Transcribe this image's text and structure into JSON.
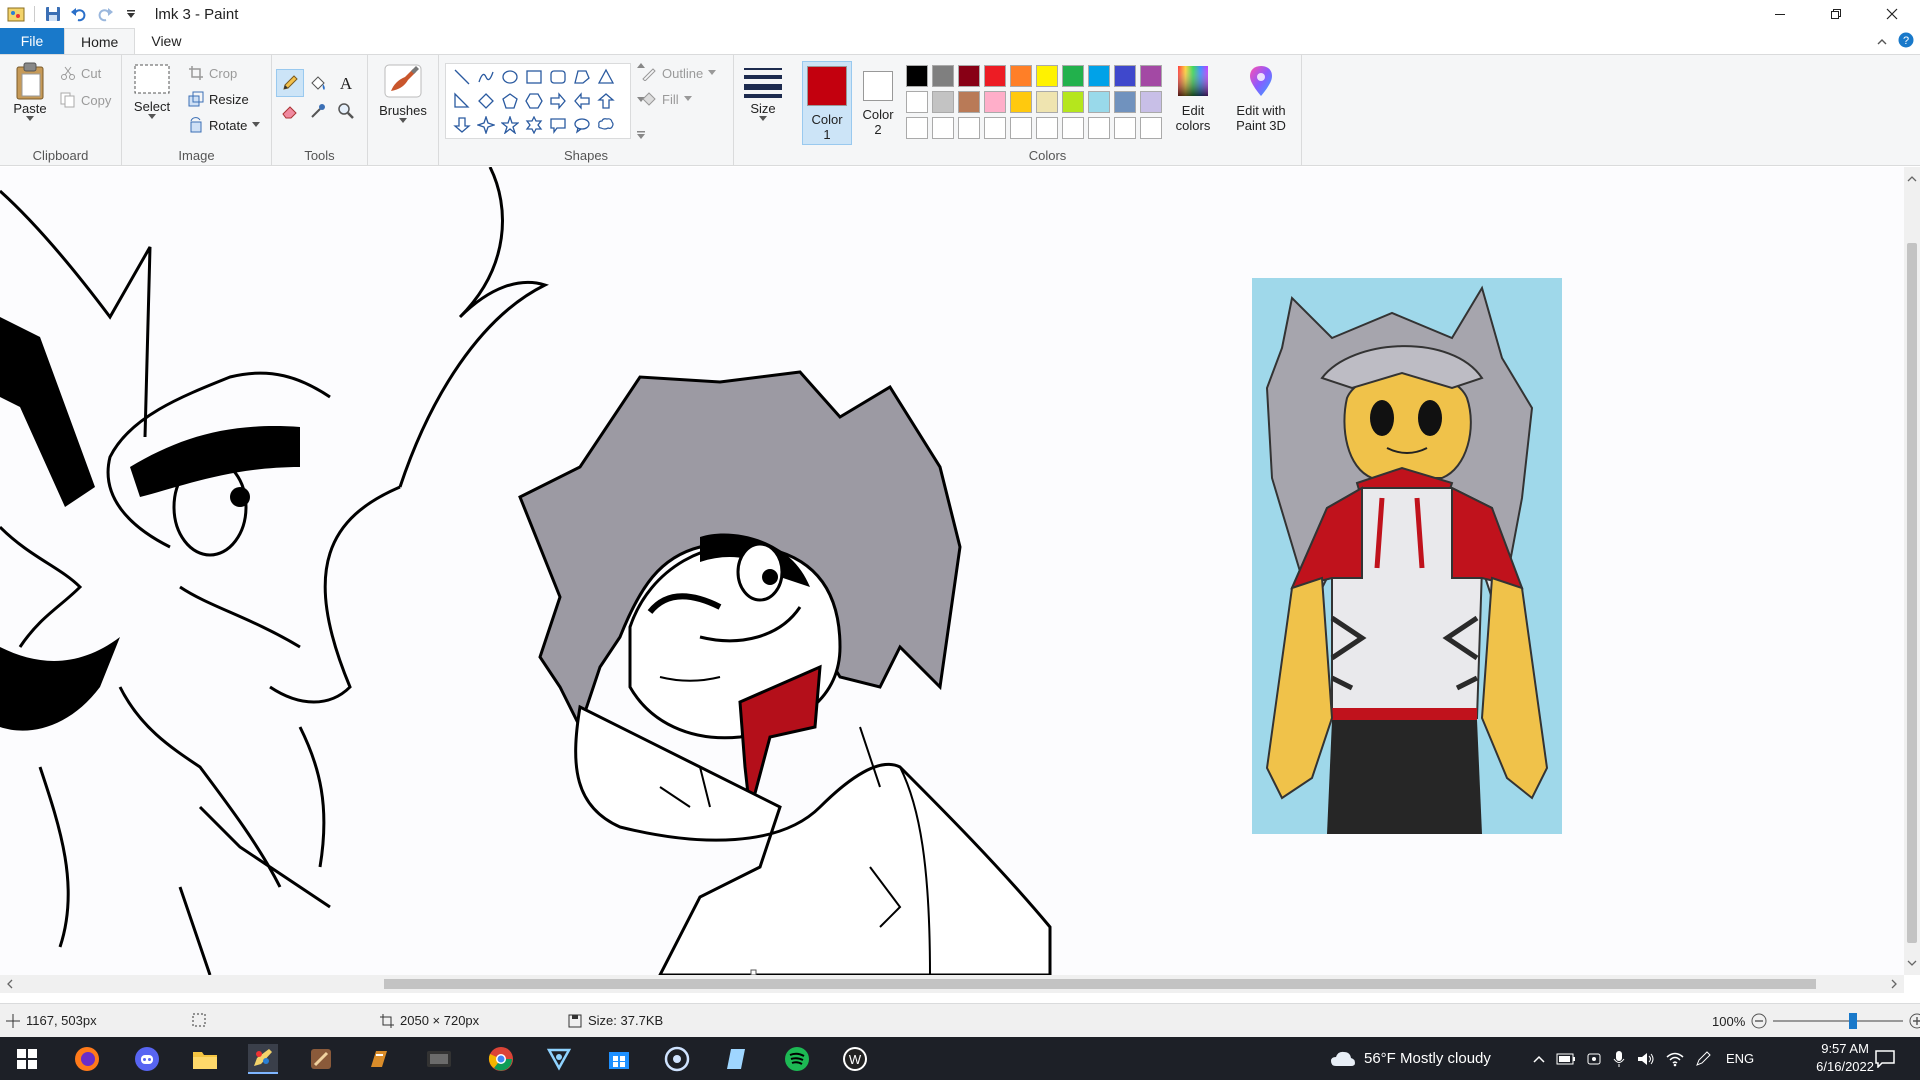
{
  "window": {
    "title": "lmk 3 - Paint"
  },
  "tabs": {
    "file": "File",
    "home": "Home",
    "view": "View"
  },
  "ribbon": {
    "clipboard": {
      "label": "Clipboard",
      "paste": "Paste",
      "cut": "Cut",
      "copy": "Copy"
    },
    "image": {
      "label": "Image",
      "select": "Select",
      "crop": "Crop",
      "resize": "Resize",
      "rotate": "Rotate"
    },
    "tools": {
      "label": "Tools"
    },
    "brushes": {
      "label": "Brushes"
    },
    "shapes": {
      "label": "Shapes",
      "outline": "Outline",
      "fill": "Fill"
    },
    "size": {
      "label": "Size"
    },
    "color1": {
      "label": "Color\n1",
      "value": "#c3000e"
    },
    "color2": {
      "label": "Color\n2",
      "value": "#ffffff"
    },
    "colors": {
      "label": "Colors",
      "palette": [
        "#000000",
        "#7f7f7f",
        "#880015",
        "#ed1c24",
        "#ff7f27",
        "#fff200",
        "#22b14c",
        "#00a2e8",
        "#3f48cc",
        "#a349a4",
        "#ffffff",
        "#c3c3c3",
        "#b97a57",
        "#ffaec9",
        "#ffc90e",
        "#efe4b0",
        "#b5e61d",
        "#99d9ea",
        "#7092be",
        "#c8bfe7",
        "#ffffff",
        "#ffffff",
        "#ffffff",
        "#ffffff",
        "#ffffff",
        "#ffffff",
        "#ffffff",
        "#ffffff",
        "#ffffff",
        "#ffffff"
      ]
    },
    "edit_colors": "Edit\ncolors",
    "paint3d": "Edit with\nPaint 3D"
  },
  "status": {
    "cursor": "1167, 503px",
    "dimensions": "2050 × 720px",
    "size": "Size: 37.7KB",
    "zoom": "100%",
    "zoom_level": 0.62
  },
  "taskbar": {
    "weather": "56°F  Mostly cloudy",
    "lang": "ENG",
    "time": "9:57 AM",
    "date": "6/16/2022"
  }
}
